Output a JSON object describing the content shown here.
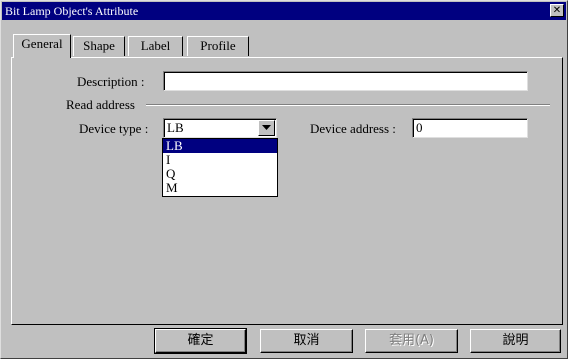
{
  "window": {
    "title": "Bit Lamp Object's Attribute",
    "close_glyph": "✕"
  },
  "tabs": [
    {
      "label": "General",
      "active": true
    },
    {
      "label": "Shape",
      "active": false
    },
    {
      "label": "Label",
      "active": false
    },
    {
      "label": "Profile",
      "active": false
    }
  ],
  "general": {
    "description_label": "Description :",
    "description_value": "",
    "read_address_group": "Read address",
    "device_type_label": "Device type :",
    "device_type_value": "LB",
    "device_type_options": [
      "LB",
      "I",
      "Q",
      "M"
    ],
    "device_address_label": "Device address :",
    "device_address_value": "0"
  },
  "buttons": {
    "ok": "確定",
    "cancel": "取消",
    "apply": "套用(A)",
    "help": "說明"
  },
  "icons": {
    "close": "close-icon",
    "dropdown": "triangle-down-icon"
  }
}
